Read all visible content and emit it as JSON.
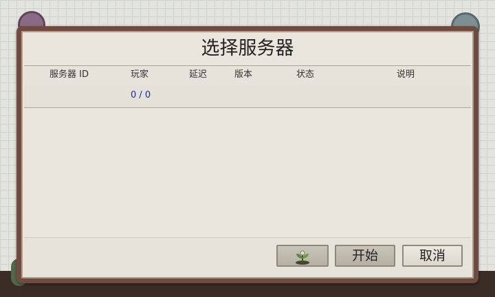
{
  "dialog": {
    "title": "选择服务器",
    "columns": {
      "server_id": "服务器 ID",
      "players": "玩家",
      "latency": "延迟",
      "version": "版本",
      "status": "状态",
      "description": "说明"
    },
    "rows": [
      {
        "server_id": "",
        "players": "0 / 0",
        "latency": "",
        "version": "",
        "status": "",
        "description": ""
      }
    ],
    "buttons": {
      "plant_icon": "sprout-icon",
      "start": "开始",
      "cancel": "取消"
    }
  },
  "colors": {
    "frame": "#6f4c3f",
    "panel": "#e9e6dd",
    "player_count": "#1b2aa0"
  }
}
